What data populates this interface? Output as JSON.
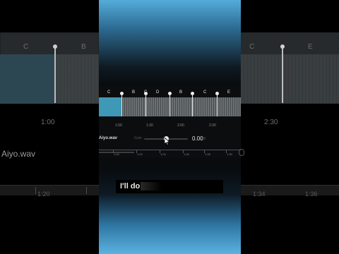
{
  "left_panel": {
    "chords": [
      "C",
      "B"
    ],
    "time": "1:00",
    "filename": "Aiyo.wav",
    "ruler_time": "1:20"
  },
  "right_panel": {
    "chords": [
      "C",
      "E"
    ],
    "time": "2:30",
    "ruler_times": [
      "1:34",
      "1:36"
    ]
  },
  "editor": {
    "chord_markers": [
      "C",
      "B",
      "C",
      "D",
      "B",
      "C",
      "E"
    ],
    "times": [
      "1:00",
      "1:30",
      "2:00",
      "2:30"
    ],
    "filename": "Aiyo.wav",
    "slider_label": "Gain",
    "value": "0.00",
    "value_unit": "dB",
    "ruler_times": [
      "1:20",
      "1:22",
      "1:24",
      "1:26",
      "1:28",
      "1:30"
    ]
  },
  "caption": {
    "text": "I'll do"
  },
  "colors": {
    "played_wave": "#3f98b6",
    "wave": "#6b7073",
    "sky": "#55acda"
  }
}
